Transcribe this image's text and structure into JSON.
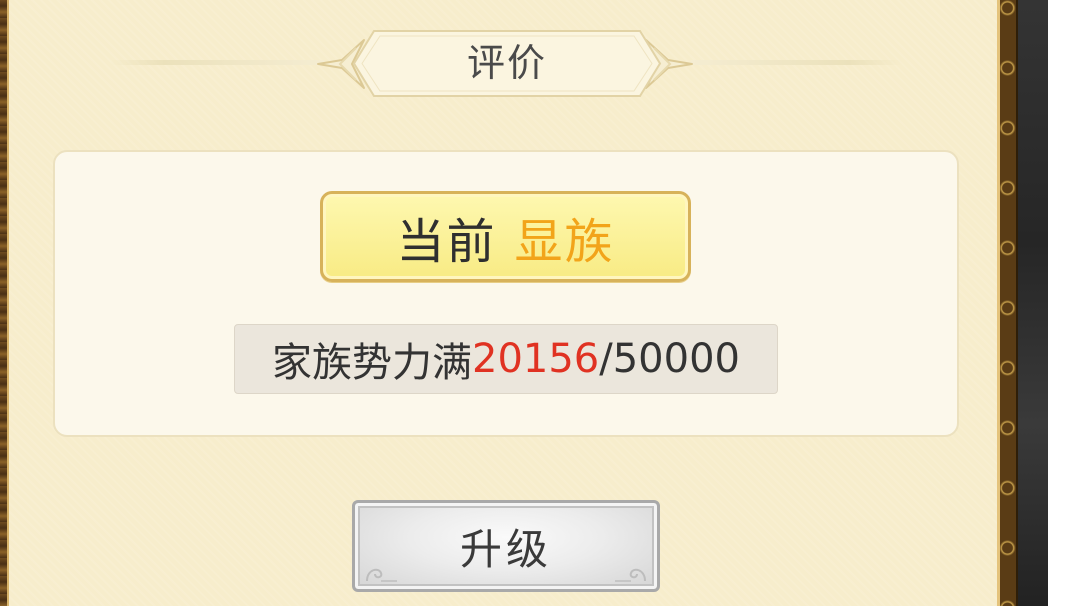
{
  "header": {
    "title": "评价"
  },
  "status": {
    "label": "当前",
    "value": "显族"
  },
  "progress": {
    "label": "家族势力满",
    "current": "20156",
    "separator": "/",
    "max": "50000"
  },
  "actions": {
    "upgrade_label": "升级"
  },
  "colors": {
    "panel_background": "#f7edcc",
    "status_value": "#f2a41a",
    "progress_current": "#e03222",
    "badge_fill": "#f8eb84"
  }
}
